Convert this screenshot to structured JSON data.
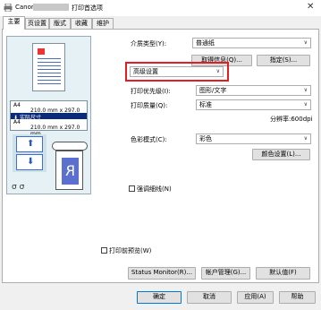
{
  "title": {
    "app": "Canon",
    "suffix": "打印首选项",
    "close": "✕"
  },
  "tabs": [
    "主要",
    "页设置",
    "版式",
    "收藏",
    "维护"
  ],
  "preview": {
    "size1": "A4",
    "dims1": "210.0 mm x 297.0 mm",
    "actual": "实际尺寸",
    "size2": "A4",
    "dims2": "210.0 mm x 297.0 mm"
  },
  "media": {
    "label": "介质类型(Y):",
    "value": "普通纸"
  },
  "get_info": "取得信息(Q)...",
  "specify": "指定(S)...",
  "advanced": {
    "value": "高级设置"
  },
  "priority": {
    "label": "打印优先级(I):",
    "value": "图形/文字"
  },
  "quality": {
    "label": "打印质量(Q):",
    "value": "标准"
  },
  "resolution": "分辨率:600dpi",
  "color_mode": {
    "label": "色彩模式(C):",
    "value": "彩色"
  },
  "color_settings": "颜色设置(L)...",
  "emphasize": "强调细线(N)",
  "preview_before": "打印前预览(W)",
  "status_monitor": "Status Monitor(R)...",
  "account": "帐户管理(G)...",
  "defaults": "默认值(F)",
  "footer": {
    "ok": "确定",
    "cancel": "取消",
    "apply": "应用(A)",
    "help": "帮助"
  },
  "colors": {
    "accent": "#0078d7",
    "highlight": "#e02020"
  }
}
